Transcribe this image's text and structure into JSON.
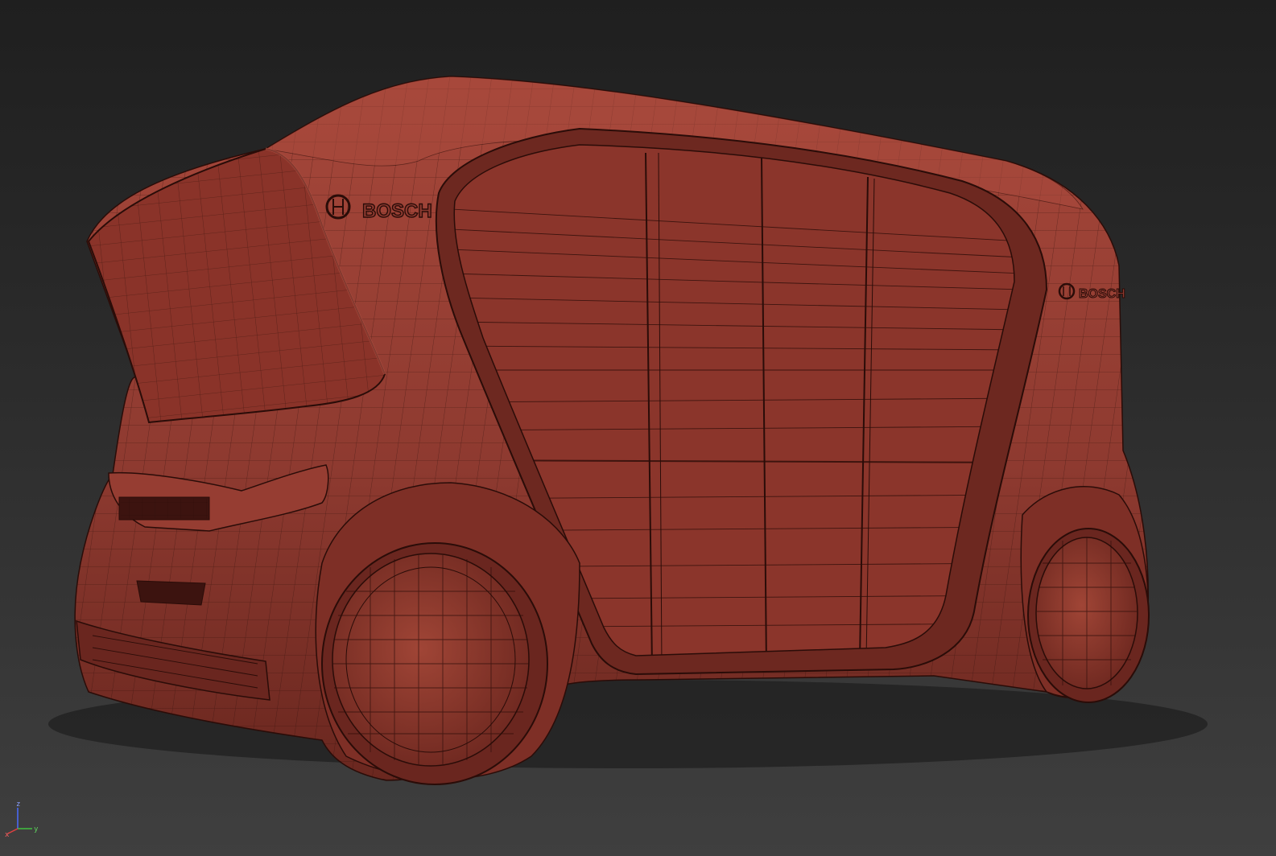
{
  "viewport": {
    "background_top": "#1f1f1f",
    "background_bottom": "#404040"
  },
  "model": {
    "body_color": "#8e3a30",
    "body_highlight": "#a6473a",
    "body_shadow": "#5c211b",
    "wire_color": "#2a0c08",
    "logos": {
      "rear": "BOSCH",
      "side": "BOSCH"
    }
  },
  "gizmo": {
    "z": "z",
    "x": "x",
    "y": "y",
    "z_color": "#4a6cff",
    "x_color": "#e04040",
    "y_color": "#40c040"
  }
}
